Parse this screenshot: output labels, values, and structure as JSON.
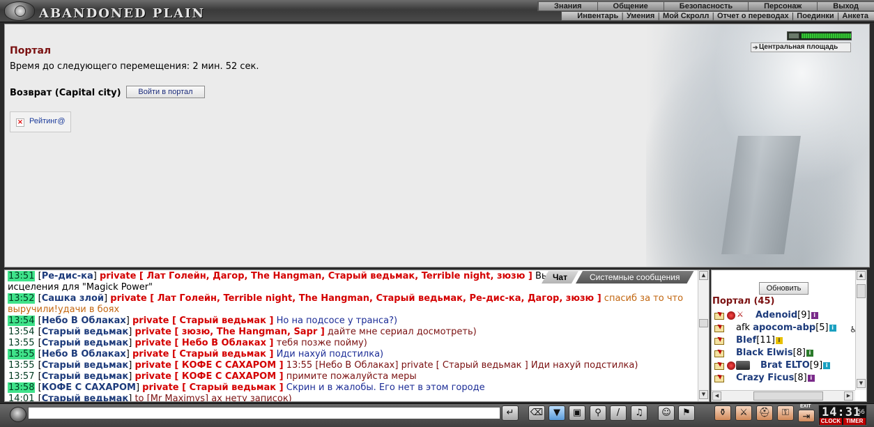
{
  "app": {
    "logo_text": "ABANDONED PLAIN"
  },
  "menu_top": [
    {
      "label": "Знания"
    },
    {
      "label": "Общение"
    },
    {
      "label": "Безопасность"
    },
    {
      "label": "Персонаж"
    },
    {
      "label": "Выход"
    }
  ],
  "menu_sub": [
    {
      "label": "Инвентарь"
    },
    {
      "label": "Умения"
    },
    {
      "label": "Мой Скролл"
    },
    {
      "label": "Отчет о переводах"
    },
    {
      "label": "Поединки"
    },
    {
      "label": "Анкета"
    }
  ],
  "location": {
    "title": "Портал",
    "timer_text": "Время до следующего перемещения: 2 мин. 52 сек.",
    "return_label": "Возврат (Capital city)",
    "portal_button": "Войти в портал",
    "rating_link": "Рейтинг@",
    "location_button": "Центральная площадь",
    "hp_fraction": 1.0
  },
  "chat": {
    "tabs": [
      {
        "label": "Чат",
        "active": true
      },
      {
        "label": "Системные сообщения",
        "active": false
      }
    ],
    "lines": [
      {
        "time": "13:51",
        "hl": true,
        "nick": "Ре-дис-ка",
        "private": "private [ Лат Голейн, Дагор, The Hangman, Старый ведьмак, Terrible night, зюзю ]",
        "text": "Вы",
        "cont": "исцеления для \"Magick Power\"",
        "color": "black"
      },
      {
        "time": "13:52",
        "hl": true,
        "nick": "Сашка злой",
        "private": "private [ Лат Голейн, Terrible night, The Hangman, Старый ведьмак, Ре-дис-ка, Дагор, зюзю ]",
        "text": "спасиб за то что",
        "cont": "выручили!удачи в боях",
        "color": "orange"
      },
      {
        "time": "13:54",
        "hl": true,
        "nick": "Небо В Облаках",
        "private": "private [ Старый ведьмак ]",
        "text": "Но на подсосе у транса?)",
        "color": "blue"
      },
      {
        "time": "13:54",
        "hl": false,
        "nick": "Старый ведьмак",
        "private": "private [ зюзю, The Hangman, Sapr ]",
        "text": "дайте мне сериал досмотреть)",
        "color": "maroon"
      },
      {
        "time": "13:55",
        "hl": false,
        "nick": "Старый ведьмак",
        "private": "private [ Небо В Облаках ]",
        "text": "тебя позже пойму)",
        "color": "maroon"
      },
      {
        "time": "13:55",
        "hl": true,
        "nick": "Небо В Облаках",
        "private": "private [ Старый ведьмак ]",
        "text": "Иди нахуй подстилка)",
        "color": "blue"
      },
      {
        "time": "13:55",
        "hl": false,
        "nick": "Старый ведьмак",
        "private": "private [ КОФЕ С САХАРОМ ]",
        "text": "13:55 [Небо В Облаках] private [ Старый ведьмак ] Иди нахуй подстилка)",
        "color": "maroon"
      },
      {
        "time": "13:57",
        "hl": false,
        "nick": "Старый ведьмак",
        "private": "private [ КОФЕ С САХАРОМ ]",
        "text": "примите пожалуйста меры",
        "color": "maroon"
      },
      {
        "time": "13:58",
        "hl": true,
        "nick": "КОФЕ С САХАРОМ",
        "private": "private [ Старый ведьмак ]",
        "text": "Скрин и в жалобы. Его нет в этом городе",
        "color": "blue"
      },
      {
        "time": "14:01",
        "hl": false,
        "nick": "Старый ведьмак",
        "private": "",
        "text": "to [Mr Maximys] ах нету записок)",
        "color": "maroon"
      }
    ]
  },
  "users": {
    "refresh_button": "Обновить",
    "title": "Портал (45)",
    "list": [
      {
        "name": "Adenoid",
        "level": "[9]",
        "afk": "",
        "clan": true,
        "align": true,
        "avatar": false,
        "info": "purple"
      },
      {
        "name": "apocom-abp",
        "level": "[5]",
        "afk": "afk ",
        "clan": false,
        "align": false,
        "avatar": false,
        "info": "cyan"
      },
      {
        "name": "BIef",
        "level": "[11]",
        "afk": "",
        "clan": false,
        "align": false,
        "avatar": false,
        "info": "yellow"
      },
      {
        "name": "Black Elwis",
        "level": "[8]",
        "afk": "",
        "clan": false,
        "align": false,
        "avatar": false,
        "info": "green"
      },
      {
        "name": "Brat ELTO",
        "level": "[9]",
        "afk": "",
        "clan": true,
        "align": false,
        "avatar": true,
        "info": "cyan"
      },
      {
        "name": "Crazy Ficus",
        "level": "[8]",
        "afk": "",
        "clan": false,
        "align": false,
        "avatar": false,
        "info": "purple"
      }
    ]
  },
  "clock": {
    "time": "14:31",
    "seconds": "56",
    "clock_label": "CLOCK",
    "timer_label": "TIMER",
    "exit_label": "EXIT"
  }
}
